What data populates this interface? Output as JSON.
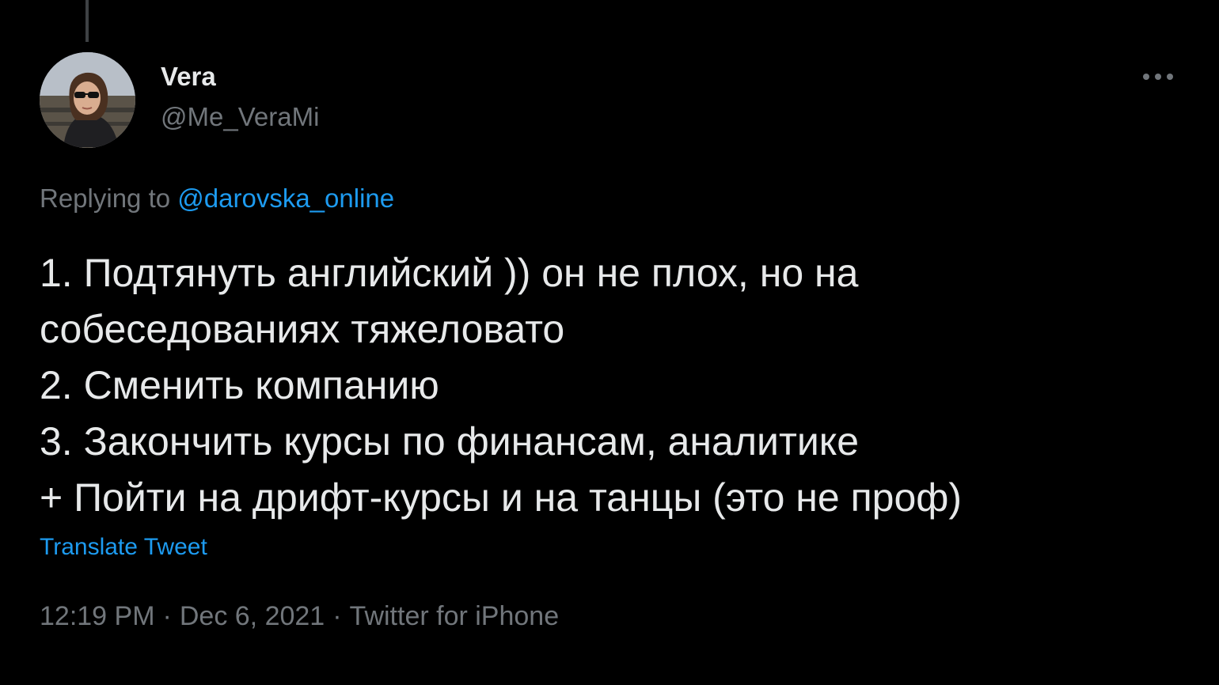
{
  "tweet": {
    "author": {
      "display_name": "Vera",
      "handle": "@Me_VeraMi",
      "avatar_icon": "profile-photo"
    },
    "replying_to": {
      "prefix": "Replying to",
      "mention": "@darovska_online"
    },
    "body_lines": [
      "1. Подтянуть английский )) он не плох, но на",
      "собеседованиях тяжеловато",
      "2. Сменить компанию",
      "3. Закончить курсы по финансам, аналитике",
      "+ Пойти на дрифт-курсы и на танцы (это не проф)"
    ],
    "translate_label": "Translate Tweet",
    "meta": {
      "time": "12:19 PM",
      "separator": "·",
      "date": "Dec 6, 2021",
      "source": "Twitter for iPhone"
    },
    "more_icon": "more-horizontal-icon"
  },
  "colors": {
    "background": "#000000",
    "primary_text": "#e7e9ea",
    "secondary_text": "#71767b",
    "accent": "#1d9bf0",
    "thread_line": "#3e4144"
  }
}
